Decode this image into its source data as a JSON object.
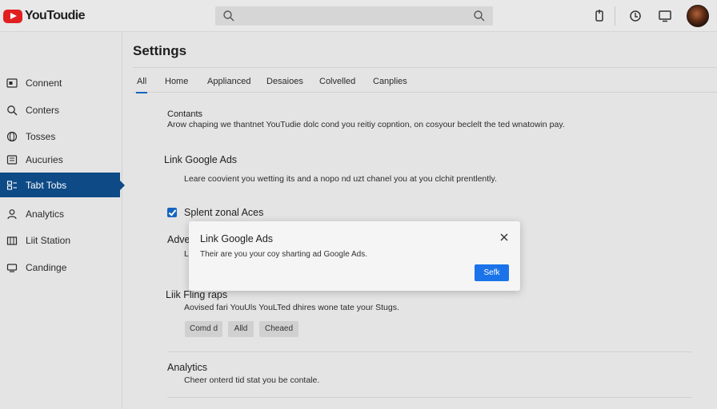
{
  "header": {
    "brand": "YouToudie",
    "search": {
      "value": "",
      "placeholder": ""
    },
    "icons": [
      "search-icon",
      "search-icon",
      "upload-icon",
      "notification-icon",
      "monitor-icon",
      "avatar"
    ]
  },
  "sidebar": {
    "items": [
      {
        "label": "Connent",
        "icon": "content-icon",
        "active": false
      },
      {
        "label": "Conters",
        "icon": "search-icon",
        "active": false
      },
      {
        "label": "Tosses",
        "icon": "globe-icon",
        "active": false
      },
      {
        "label": "Aucuries",
        "icon": "library-icon",
        "active": false
      },
      {
        "label": "Tabt Tobs",
        "icon": "tabs-icon",
        "active": true
      },
      {
        "label": "Analytics",
        "icon": "person-icon",
        "active": false
      },
      {
        "label": "Liit Station",
        "icon": "station-icon",
        "active": false
      },
      {
        "label": "Candinge",
        "icon": "settings-icon",
        "active": false
      }
    ]
  },
  "main": {
    "title": "Settings",
    "tabs": [
      {
        "label": "All",
        "active": true
      },
      {
        "label": "Home",
        "active": false
      },
      {
        "label": "Applianced",
        "active": false
      },
      {
        "label": "Desaioes",
        "active": false
      },
      {
        "label": "Colvelled",
        "active": false
      },
      {
        "label": "Canplies",
        "active": false
      }
    ],
    "sections": {
      "contents": {
        "title": "Contants",
        "desc": "Arow chaping we thantnet YouTudie dolc cond you reitiy copntion, on cosyour beclelt the ted wnatowin pay."
      },
      "link_google_ads": {
        "title": "Link Google Ads",
        "desc": "Leare coovient you wetting its and a nopo nd uzt chanel you at you clchit prentlently."
      },
      "checkbox": {
        "label": "Splent zonal Aces",
        "checked": true
      },
      "advertising": {
        "title": "Adve",
        "desc": "L"
      },
      "link_fling": {
        "title": "Liik Fling raps",
        "desc": "Aovised fari YouUls YouLTed dhires wone tate your Stugs."
      },
      "chips": [
        "Comd d",
        "Alld",
        "Cheaed"
      ],
      "analytics": {
        "title": "Analytics",
        "desc": "Cheer onterd tid stat you be contale."
      }
    }
  },
  "modal": {
    "title": "Link Google Ads",
    "desc": "Their are you your coy sharting ad Google Ads.",
    "button": "Sefk"
  },
  "colors": {
    "accent": "#1565c0",
    "sidebar_active": "#0d4a86",
    "brand_red": "#e02020",
    "background": "#e4e4e4"
  }
}
